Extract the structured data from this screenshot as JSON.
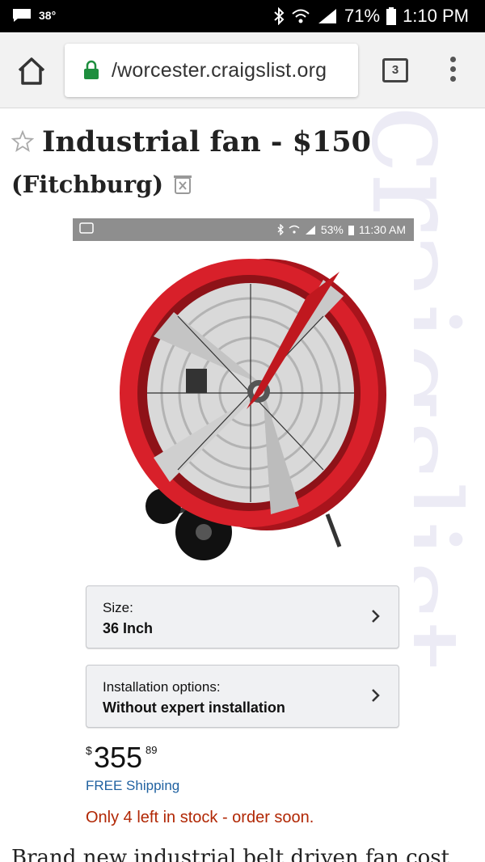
{
  "status_bar": {
    "temperature": "38°",
    "battery": "71%",
    "time": "1:10 PM"
  },
  "browser": {
    "url_prefix": "/",
    "url": "/worcester.craigslist.org",
    "tab_count": "3",
    "icons": [
      "home-icon",
      "lock-icon",
      "tabs-icon",
      "more-vert-icon"
    ]
  },
  "post": {
    "title": "Industrial fan - $150",
    "location": "(Fitchburg)",
    "body_preview": "Brand new industrial belt driven fan cost"
  },
  "watermark": "craigslist",
  "embedded": {
    "status_battery": "53%",
    "status_time": "11:30 AM",
    "option_size": {
      "label": "Size:",
      "value": "36 Inch"
    },
    "option_install": {
      "label": "Installation options:",
      "value": "Without expert installation"
    },
    "price": {
      "currency": "$",
      "whole": "355",
      "fraction": "89"
    },
    "shipping": "FREE Shipping",
    "stock": "Only 4 left in stock - order soon."
  },
  "colors": {
    "fan_red": "#d8202a",
    "accent_blue": "#2162a1",
    "stock_red": "#b12704",
    "lock_green": "#1e8e3e"
  }
}
